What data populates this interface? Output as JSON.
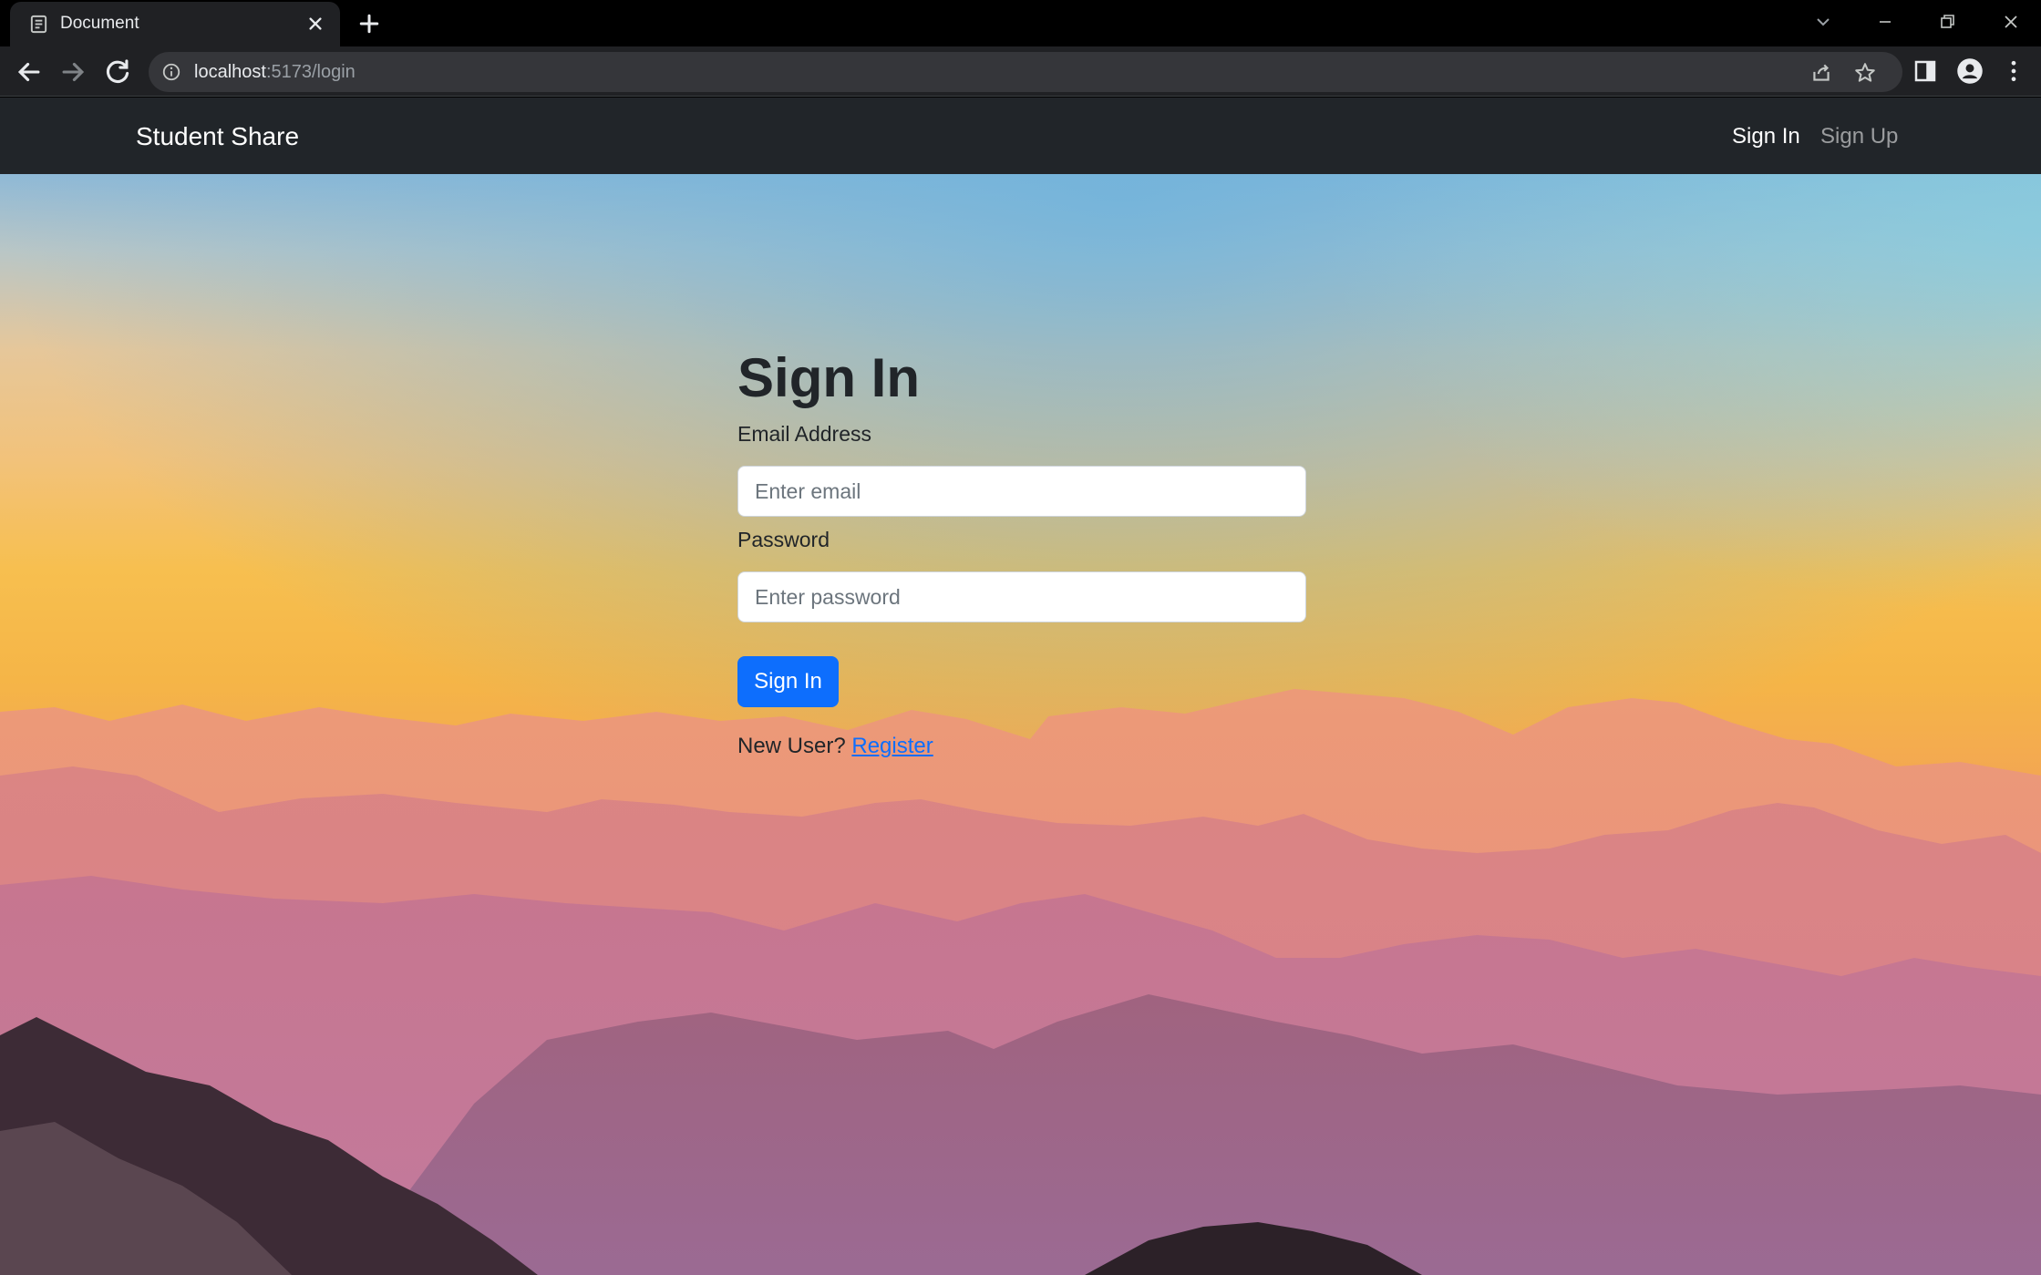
{
  "browser": {
    "tab_title": "Document",
    "url_host": "localhost",
    "url_rest": ":5173/login"
  },
  "navbar": {
    "brand": "Student Share",
    "links": [
      {
        "label": "Sign In",
        "active": true
      },
      {
        "label": "Sign Up",
        "active": false
      }
    ]
  },
  "form": {
    "title": "Sign In",
    "email_label": "Email Address",
    "email_placeholder": "Enter email",
    "email_value": "",
    "password_label": "Password",
    "password_placeholder": "Enter password",
    "password_value": "",
    "submit_label": "Sign In",
    "new_user_text": "New User?",
    "register_link": "Register"
  },
  "colors": {
    "navbar_bg": "#212529",
    "primary": "#0d6efd",
    "chrome_bg": "#202124"
  }
}
